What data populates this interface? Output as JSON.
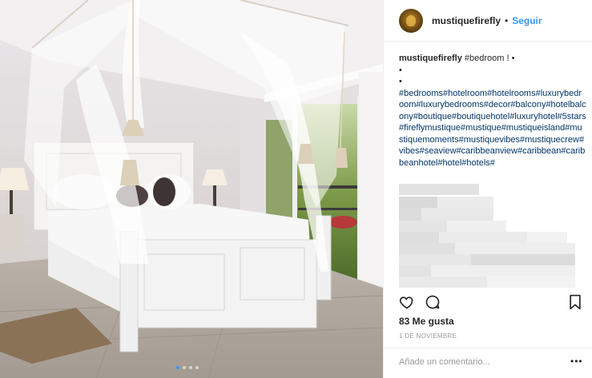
{
  "post": {
    "username": "mustiquefirefly",
    "separator": "•",
    "follow_label": "Seguir",
    "caption_user": "mustiquefirefly",
    "caption_first": " #bedroom ! •",
    "caption_dot1": "•",
    "caption_dot2": "•",
    "caption_tags": "#bedrooms#hotelroom#hotelrooms#luxurybedroom#luxurybedrooms#decor#balcony#hotelbalcony#boutique#boutiquehotel#luxuryhotel#5stars#fireflymustique#mustique#mustiqueisland#mustiquemoments#mustiquevibes#mustiquecrew#vibes#seaview#caribbeanview#caribbean#caribbeanhotel#hotel#hotels#",
    "likes": "83 Me gusta",
    "date": "1 DE NOVIEMBRE",
    "comment_placeholder": "Añade un comentario...",
    "more_label": "•••"
  },
  "icons": {
    "like": "heart-icon",
    "comment": "comment-icon",
    "save": "bookmark-icon"
  },
  "carousel": {
    "slides": 4,
    "active_index": 0
  },
  "colors": {
    "accent": "#3897f0",
    "text": "#262626",
    "muted": "#999999"
  }
}
